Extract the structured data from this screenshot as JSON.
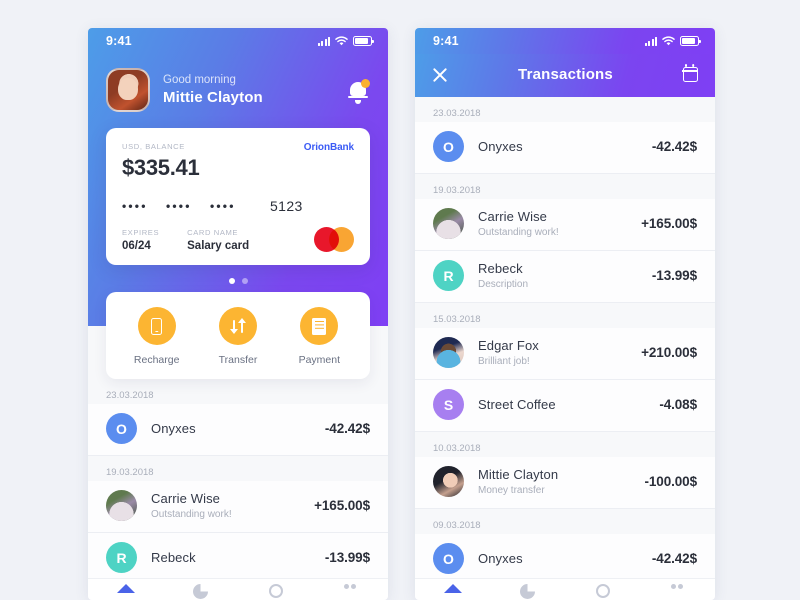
{
  "status_bar": {
    "time": "9:41",
    "signal_icon": "signal-bars-icon",
    "wifi_icon": "wifi-icon",
    "battery_icon": "battery-icon"
  },
  "colors": {
    "gradient_start": "#4d9de8",
    "gradient_end": "#7f3ff4",
    "accent_orange": "#fcb532",
    "brand_blue": "#3b5bf5",
    "nav_active": "#4a63e8"
  },
  "home": {
    "greeting": "Good morning",
    "user_name": "Mittie Clayton",
    "avatar_name": "user-avatar",
    "bell_icon": "notification-bell-icon",
    "card": {
      "balance_label": "USD, BALANCE",
      "balance": "$335.41",
      "bank_name": "OrionBank",
      "masked_group": "••••",
      "last_digits": "5123",
      "expires_label": "EXPIRES",
      "expires_value": "06/24",
      "card_name_label": "CARD NAME",
      "card_name_value": "Salary card",
      "network_icon": "mastercard-logo"
    },
    "pagination": {
      "total": 2,
      "active_index": 0
    },
    "actions": [
      {
        "label": "Recharge",
        "icon": "phone-icon"
      },
      {
        "label": "Transfer",
        "icon": "transfer-arrows-icon"
      },
      {
        "label": "Payment",
        "icon": "receipt-icon"
      }
    ],
    "transactions": [
      {
        "date": "23.03.2018",
        "name": "Onyxes",
        "sub": "",
        "amount": "-42.42$",
        "avatar_type": "initial",
        "initial": "O",
        "color": "#5b8def"
      },
      {
        "date": "19.03.2018",
        "name": "Carrie Wise",
        "sub": "Outstanding work!",
        "amount": "+165.00$",
        "avatar_type": "photo",
        "photo": "carrie"
      },
      {
        "date": "",
        "name": "Rebeck",
        "sub": "",
        "amount": "-13.99$",
        "avatar_type": "initial",
        "initial": "R",
        "color": "#4ed3c4"
      }
    ]
  },
  "transactions_screen": {
    "title": "Transactions",
    "close_icon": "close-icon",
    "calendar_icon": "calendar-icon",
    "transactions": [
      {
        "date": "23.03.2018",
        "name": "Onyxes",
        "sub": "",
        "amount": "-42.42$",
        "avatar_type": "initial",
        "initial": "O",
        "color": "#5b8def"
      },
      {
        "date": "19.03.2018",
        "name": "Carrie Wise",
        "sub": "Outstanding work!",
        "amount": "+165.00$",
        "avatar_type": "photo",
        "photo": "carrie"
      },
      {
        "date": "",
        "name": "Rebeck",
        "sub": "Description",
        "amount": "-13.99$",
        "avatar_type": "initial",
        "initial": "R",
        "color": "#4ed3c4"
      },
      {
        "date": "15.03.2018",
        "name": "Edgar Fox",
        "sub": "Brilliant job!",
        "amount": "+210.00$",
        "avatar_type": "photo",
        "photo": "edgar"
      },
      {
        "date": "",
        "name": "Street Coffee",
        "sub": "",
        "amount": "-4.08$",
        "avatar_type": "initial",
        "initial": "S",
        "color": "#a77ff0"
      },
      {
        "date": "10.03.2018",
        "name": "Mittie Clayton",
        "sub": "Money transfer",
        "amount": "-100.00$",
        "avatar_type": "photo",
        "photo": "mittie"
      },
      {
        "date": "09.03.2018",
        "name": "Onyxes",
        "sub": "",
        "amount": "-42.42$",
        "avatar_type": "initial",
        "initial": "O",
        "color": "#5b8def"
      }
    ]
  },
  "bottom_nav": [
    {
      "icon": "home-icon",
      "active": true
    },
    {
      "icon": "chart-pie-icon",
      "active": false
    },
    {
      "icon": "user-icon",
      "active": false
    },
    {
      "icon": "grid-menu-icon",
      "active": false
    }
  ]
}
